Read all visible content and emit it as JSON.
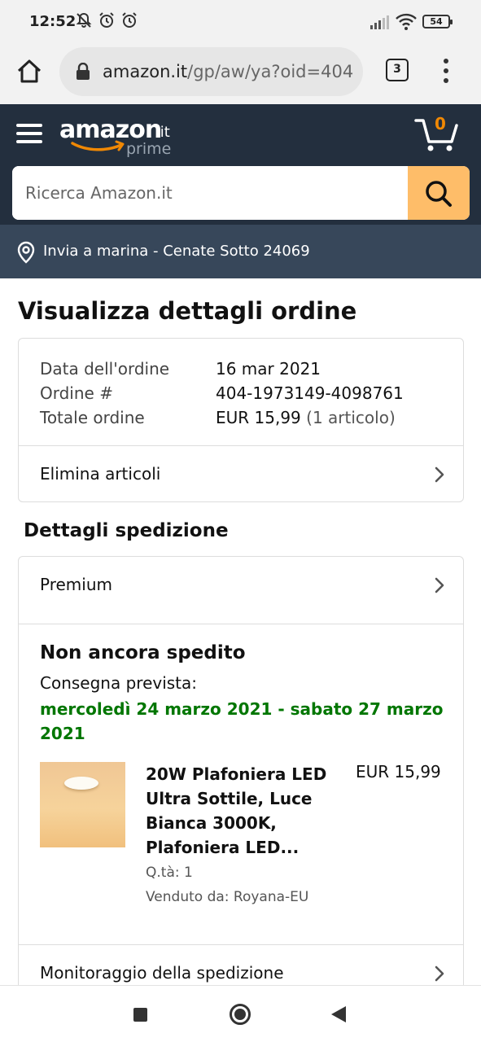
{
  "status_bar": {
    "time": "12:52",
    "battery": "54",
    "icons": [
      "mute-notifications-icon",
      "alarm-icon",
      "alarm-icon",
      "signal-icon",
      "wifi-icon",
      "battery-icon"
    ]
  },
  "browser": {
    "url_host": "amazon.it",
    "url_path": "/gp/aw/ya?oid=404",
    "tab_count": "3"
  },
  "header": {
    "logo_text": "amazon",
    "logo_tld": ".it",
    "logo_prime": "prime",
    "cart_count": "0",
    "search_placeholder": "Ricerca Amazon.it",
    "deliver_to": "Invia a marina - Cenate Sotto 24069"
  },
  "order": {
    "page_title": "Visualizza dettagli ordine",
    "summary": [
      {
        "label": "Data dell'ordine",
        "value": "16 mar 2021"
      },
      {
        "label": "Ordine #",
        "value": "404-1973149-4098761"
      },
      {
        "label": "Totale ordine",
        "value": "EUR 15,99",
        "extra": "(1 articolo)"
      }
    ],
    "delete_items_label": "Elimina articoli"
  },
  "shipment": {
    "section_title": "Dettagli spedizione",
    "shipping_speed": "Premium",
    "status": "Non ancora spedito",
    "delivery_label": "Consegna prevista:",
    "delivery_date": "mercoledì 24 marzo 2021 - sabato 27 marzo 2021",
    "item": {
      "title": "20W Plafoniera LED Ultra Sottile, Luce Bianca 3000K, Plafoniera LED...",
      "price": "EUR 15,99",
      "qty": "Q.tà: 1",
      "seller": "Venduto da: Royana-EU"
    },
    "tracking_label": "Monitoraggio della spedizione"
  },
  "colors": {
    "header_bg": "#232f3e",
    "deliver_bar_bg": "#37475a",
    "search_button": "#febd69",
    "delivery_green": "#007600",
    "cart_count": "#f08804"
  }
}
